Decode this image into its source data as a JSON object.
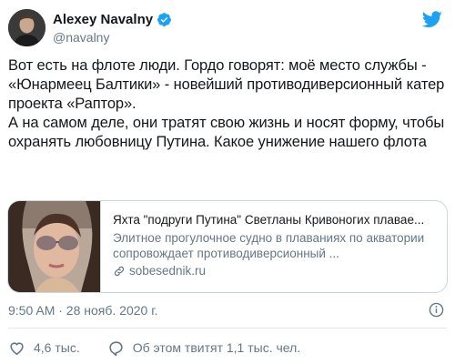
{
  "author": {
    "name": "Alexey Navalny",
    "handle": "@navalny",
    "verified": true
  },
  "tweet": {
    "text": "Вот есть на флоте люди. Гордо говорят: моё место службы - «Юнармеец Балтики» - новейший противодиверсионный катер проекта «Раптор».\nА на самом деле, они тратят свою жизнь и носят форму, чтобы охранять любовницу Путина. Какое унижение нашего флота",
    "timestamp": "9:50 AM · 28 нояб. 2020 г."
  },
  "link_card": {
    "title": "Яхта \"подруги Путина\" Светланы Кривоногих плавае...",
    "description": "Элитное прогулочное судно в плаваниях по акватории сопровождает противодиверсионный ...",
    "domain": "sobesednik.ru"
  },
  "actions": {
    "likes": "4,6 тыс.",
    "discussion": "Об этом твитят 1,1 тыс. чел."
  },
  "colors": {
    "primary_text": "#14171a",
    "secondary_text": "#657786",
    "twitter_blue": "#1da1f2",
    "border": "#ccd6dd"
  },
  "icons": [
    "twitter-bird-icon",
    "verified-badge-icon",
    "link-icon",
    "info-icon",
    "heart-icon",
    "comment-icon"
  ]
}
